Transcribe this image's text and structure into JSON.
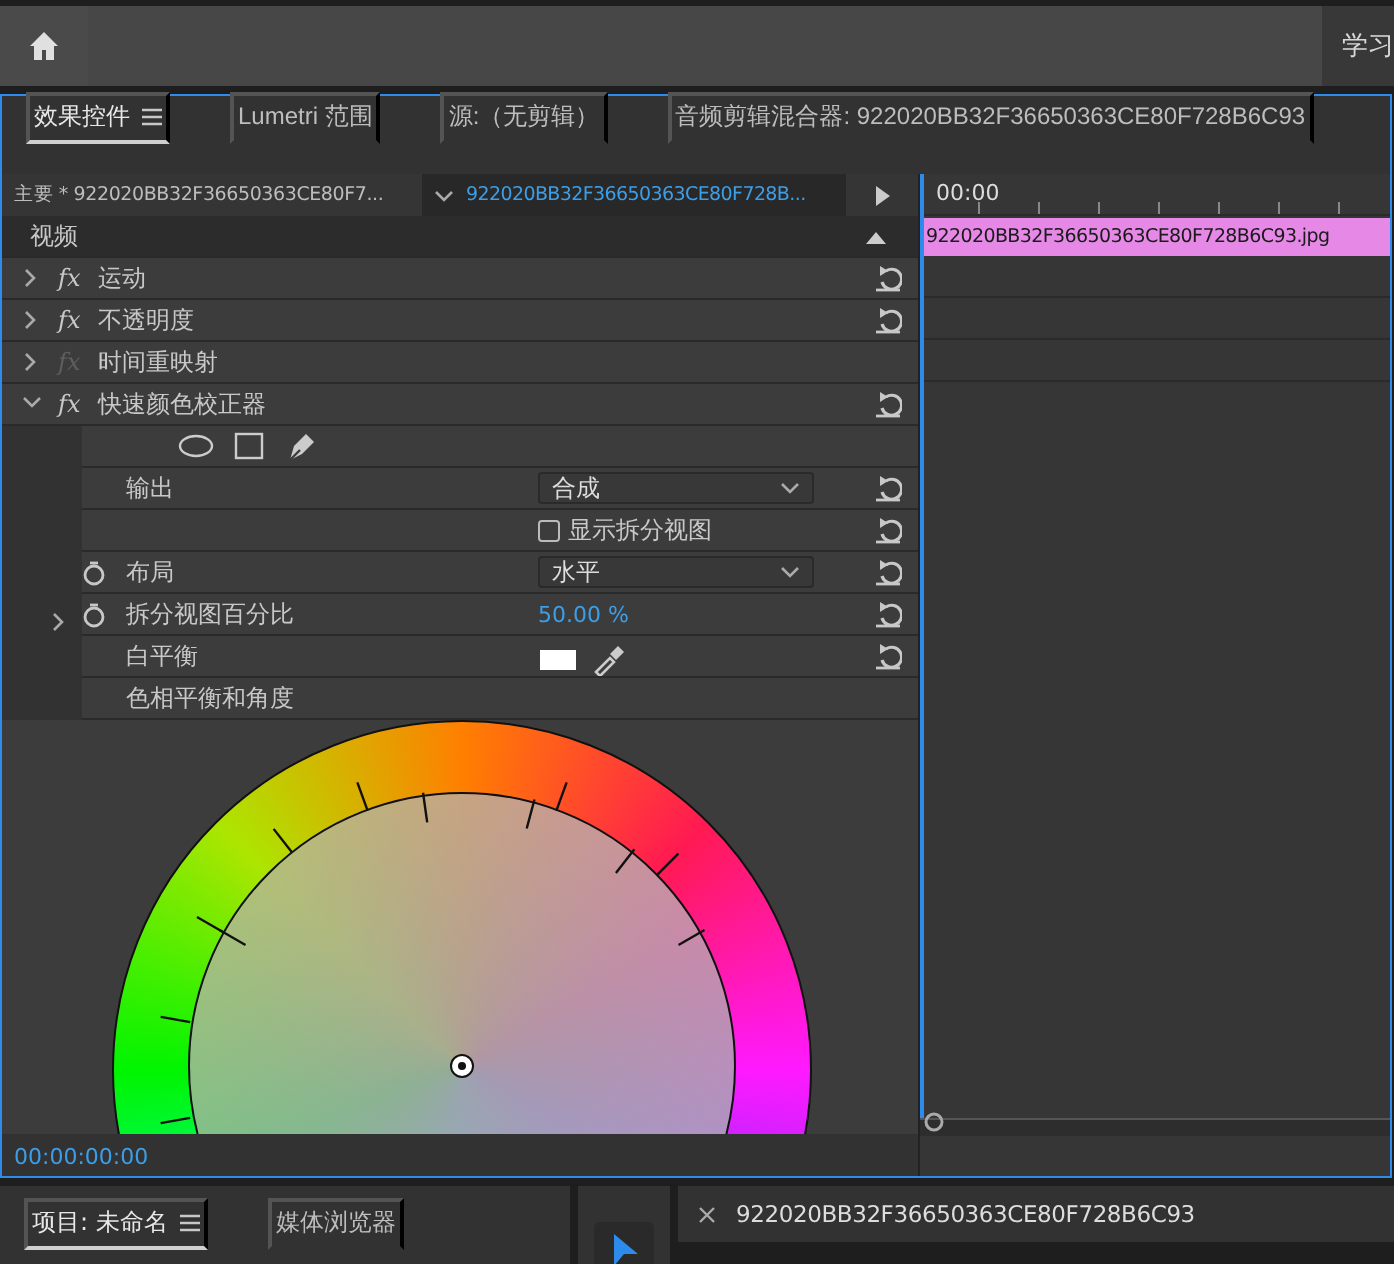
{
  "top_bar": {
    "workspace_tab": "学习"
  },
  "panel_tabs": [
    {
      "label": "效果控件",
      "selected": true,
      "menu": true
    },
    {
      "label": "Lumetri 范围",
      "selected": false,
      "menu": false
    },
    {
      "label": "源:（无剪辑）",
      "selected": false,
      "menu": false
    },
    {
      "label": "音频剪辑混合器: 922020BB32F36650363CE80F728B6C93",
      "selected": false,
      "menu": false
    }
  ],
  "clip_selector": {
    "master": "主要 * 922020BB32F36650363CE80F7...",
    "sequence": "922020BB32F36650363CE80F728B..."
  },
  "timeline": {
    "start": "00:00",
    "clip": "922020BB32F36650363CE80F728B6C93.jpg"
  },
  "section": "视频",
  "effects": [
    {
      "fx": "fx",
      "name": "运动",
      "expanded": false,
      "enabled": true,
      "reset": true
    },
    {
      "fx": "fx",
      "name": "不透明度",
      "expanded": false,
      "enabled": true,
      "reset": true
    },
    {
      "fx": "fx",
      "name": "时间重映射",
      "expanded": false,
      "enabled": false,
      "reset": false
    },
    {
      "fx": "fx",
      "name": "快速颜色校正器",
      "expanded": true,
      "enabled": true,
      "reset": true
    }
  ],
  "properties": [
    {
      "kind": "shapes",
      "reset": false
    },
    {
      "kind": "dropdown",
      "label": "输出",
      "value": "合成",
      "stopwatch": false,
      "reset": true
    },
    {
      "kind": "checkbox",
      "label": "显示拆分视图",
      "checked": false,
      "reset": true
    },
    {
      "kind": "dropdown",
      "label": "布局",
      "value": "水平",
      "stopwatch": true,
      "reset": true
    },
    {
      "kind": "number",
      "label": "拆分视图百分比",
      "value": "50.00 %",
      "stopwatch": true,
      "reset": true
    },
    {
      "kind": "color",
      "label": "白平衡",
      "color": "#ffffff",
      "stopwatch": false,
      "reset": true
    },
    {
      "kind": "heading",
      "label": "色相平衡和角度",
      "stopwatch": false,
      "reset": false
    }
  ],
  "timecode": "00:00:00:00",
  "project_tabs": [
    {
      "label": "项目: 未命名",
      "selected": true,
      "menu": true
    },
    {
      "label": "媒体浏览器",
      "selected": false,
      "menu": false
    }
  ],
  "sequence_tab": {
    "label": "922020BB32F36650363CE80F728B6C93"
  }
}
